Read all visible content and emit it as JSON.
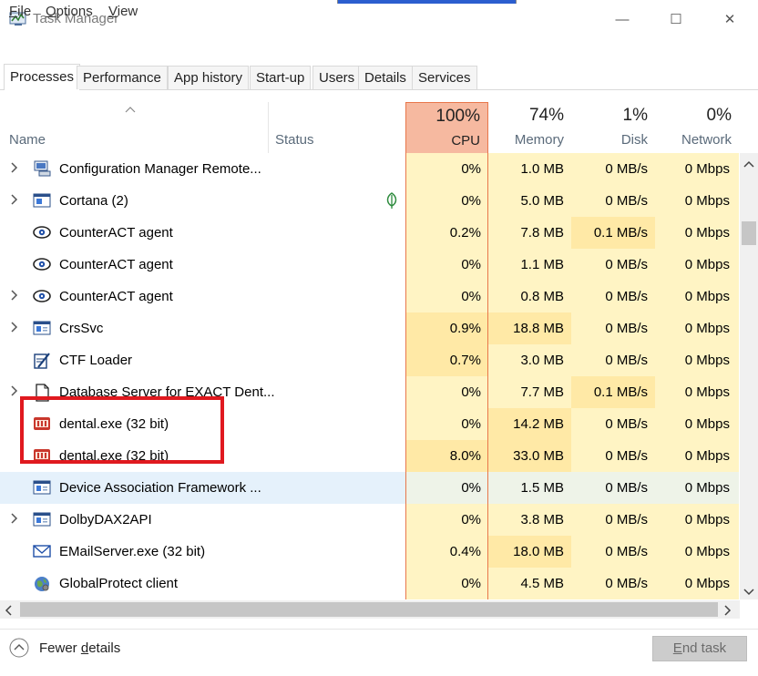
{
  "window": {
    "title": "Task Manager",
    "minimize_glyph": "—",
    "maximize_glyph": "☐",
    "close_glyph": "✕"
  },
  "menu": [
    {
      "label": "File",
      "accel": "F",
      "rest": "ile"
    },
    {
      "label": "Options",
      "accel": "O",
      "rest": "ptions"
    },
    {
      "label": "View",
      "accel": "V",
      "rest": "iew"
    }
  ],
  "tabs": [
    "Processes",
    "Performance",
    "App history",
    "Start-up",
    "Users",
    "Details",
    "Services"
  ],
  "active_tab": "Processes",
  "columns": {
    "name": "Name",
    "status": "Status",
    "cpu": {
      "percent": "100%",
      "label": "CPU"
    },
    "memory": {
      "percent": "74%",
      "label": "Memory"
    },
    "disk": {
      "percent": "1%",
      "label": "Disk"
    },
    "network": {
      "percent": "0%",
      "label": "Network"
    }
  },
  "colors": {
    "cpu_header": "#f6b9a0",
    "cpu_header_border": "#e8774b",
    "heat_light": "#fff4c4",
    "heat_mid": "#ffe9a6",
    "selected_row": "#e5f1fb",
    "highlight_box": "#e0191f"
  },
  "rows": [
    {
      "expand": true,
      "icon": "config-manager-icon",
      "name": "Configuration Manager Remote...",
      "status_icon": "",
      "cpu": "0%",
      "memory": "1.0 MB",
      "disk": "0 MB/s",
      "network": "0 Mbps"
    },
    {
      "expand": true,
      "icon": "cortana-icon",
      "name": "Cortana (2)",
      "status_icon": "leaf-icon",
      "cpu": "0%",
      "memory": "5.0 MB",
      "disk": "0 MB/s",
      "network": "0 Mbps"
    },
    {
      "expand": false,
      "icon": "counteract-eye-icon",
      "name": "CounterACT agent",
      "status_icon": "",
      "cpu": "0.2%",
      "memory": "7.8 MB",
      "disk": "0.1 MB/s",
      "network": "0 Mbps"
    },
    {
      "expand": false,
      "icon": "counteract-eye-icon",
      "name": "CounterACT agent",
      "status_icon": "",
      "cpu": "0%",
      "memory": "1.1 MB",
      "disk": "0 MB/s",
      "network": "0 Mbps"
    },
    {
      "expand": true,
      "icon": "counteract-eye-icon",
      "name": "CounterACT agent",
      "status_icon": "",
      "cpu": "0%",
      "memory": "0.8 MB",
      "disk": "0 MB/s",
      "network": "0 Mbps"
    },
    {
      "expand": true,
      "icon": "service-window-icon",
      "name": "CrsSvc",
      "status_icon": "",
      "cpu": "0.9%",
      "memory": "18.8 MB",
      "disk": "0 MB/s",
      "network": "0 Mbps"
    },
    {
      "expand": false,
      "icon": "ctf-loader-icon",
      "name": "CTF Loader",
      "status_icon": "",
      "cpu": "0.7%",
      "memory": "3.0 MB",
      "disk": "0 MB/s",
      "network": "0 Mbps"
    },
    {
      "expand": true,
      "icon": "document-icon",
      "name": "Database Server for EXACT Dent...",
      "status_icon": "",
      "cpu": "0%",
      "memory": "7.7 MB",
      "disk": "0.1 MB/s",
      "network": "0 Mbps"
    },
    {
      "expand": false,
      "icon": "dental-app-icon",
      "name": "dental.exe (32 bit)",
      "status_icon": "",
      "cpu": "0%",
      "memory": "14.2 MB",
      "disk": "0 MB/s",
      "network": "0 Mbps"
    },
    {
      "expand": false,
      "icon": "dental-app-icon",
      "name": "dental.exe (32 bit)",
      "status_icon": "",
      "cpu": "8.0%",
      "memory": "33.0 MB",
      "disk": "0 MB/s",
      "network": "0 Mbps"
    },
    {
      "expand": false,
      "icon": "service-window-icon",
      "name": "Device Association Framework ...",
      "status_icon": "",
      "cpu": "0%",
      "memory": "1.5 MB",
      "disk": "0 MB/s",
      "network": "0 Mbps"
    },
    {
      "expand": true,
      "icon": "service-window-icon",
      "name": "DolbyDAX2API",
      "status_icon": "",
      "cpu": "0%",
      "memory": "3.8 MB",
      "disk": "0 MB/s",
      "network": "0 Mbps"
    },
    {
      "expand": false,
      "icon": "email-icon",
      "name": "EMailServer.exe (32 bit)",
      "status_icon": "",
      "cpu": "0.4%",
      "memory": "18.0 MB",
      "disk": "0 MB/s",
      "network": "0 Mbps"
    },
    {
      "expand": false,
      "icon": "globe-icon",
      "name": "GlobalProtect client",
      "status_icon": "",
      "cpu": "0%",
      "memory": "4.5 MB",
      "disk": "0 MB/s",
      "network": "0 Mbps"
    }
  ],
  "footer": {
    "fewer_details": "Fewer details",
    "fewer_accel_pre": "Fewer ",
    "fewer_accel": "d",
    "fewer_accel_post": "etails",
    "end_task": "End task",
    "end_task_accel": "E",
    "end_task_post": "nd task"
  }
}
